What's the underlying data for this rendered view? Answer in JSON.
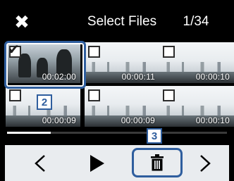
{
  "header": {
    "close_icon": "close-icon",
    "title": "Select Files",
    "counter": "1/34"
  },
  "thumbnails": [
    {
      "time": "00:02:00",
      "selected": true,
      "scene": "people"
    },
    {
      "time": "00:00:11",
      "selected": false,
      "scene": "skyline"
    },
    {
      "time": "00:00:10",
      "selected": false,
      "scene": "skyline"
    },
    {
      "time": "00:00:09",
      "selected": false,
      "scene": "skyline"
    },
    {
      "time": "00:00:09",
      "selected": false,
      "scene": "skyline"
    },
    {
      "time": "00:00:10",
      "selected": false,
      "scene": "skyline"
    }
  ],
  "callouts": {
    "selection_step": "2",
    "delete_step": "3"
  },
  "scroll": {
    "position_fraction": 0.0
  },
  "toolbar": {
    "prev_icon": "chevron-left-icon",
    "play_icon": "play-icon",
    "delete_icon": "trash-icon",
    "next_icon": "chevron-right-icon"
  },
  "colors": {
    "accent": "#2f5e9e",
    "background": "#000000",
    "toolbar_bg": "#e9ecef"
  }
}
